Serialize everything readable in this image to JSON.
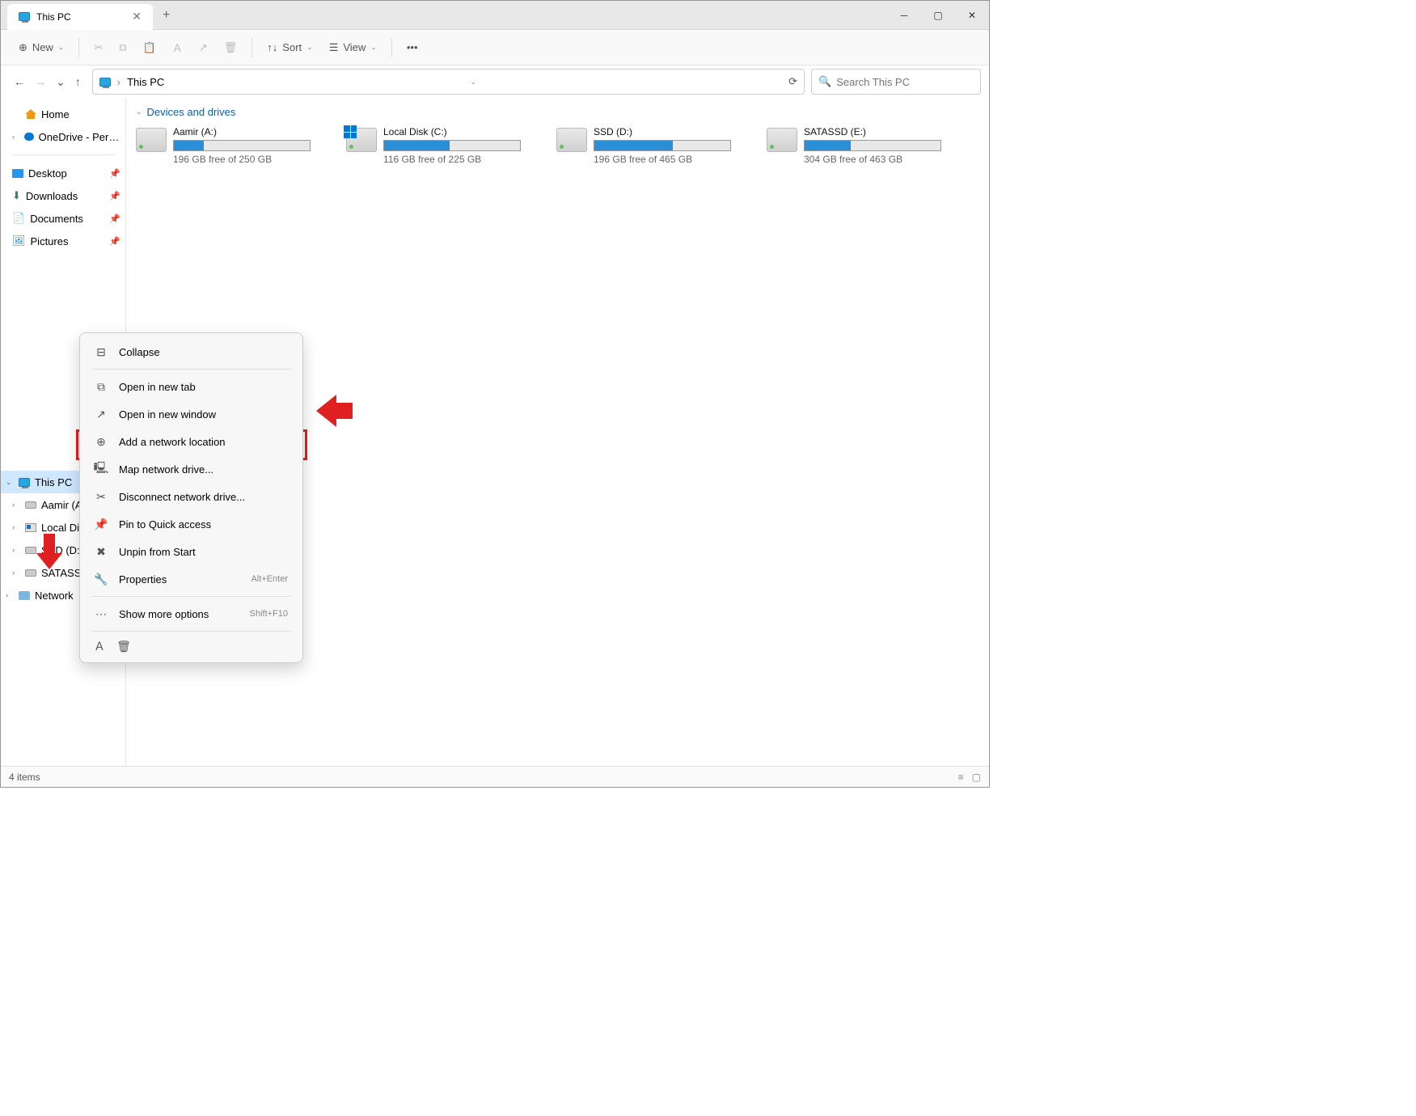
{
  "tab": {
    "title": "This PC"
  },
  "toolbar": {
    "new": "New",
    "sort": "Sort",
    "view": "View"
  },
  "address": {
    "path": "This PC"
  },
  "search": {
    "placeholder": "Search This PC"
  },
  "sidebar": {
    "home": "Home",
    "onedrive": "OneDrive - Personal",
    "quick": {
      "desktop": "Desktop",
      "downloads": "Downloads",
      "documents": "Documents",
      "pictures": "Pictures"
    },
    "thispc": "This PC",
    "drives": {
      "a": "Aamir (A:)",
      "c": "Local Disk (C:)",
      "d": "SSD (D:)",
      "e": "SATASSD (E:)"
    },
    "network": "Network"
  },
  "content": {
    "group": "Devices and drives",
    "drives": [
      {
        "name": "Aamir (A:)",
        "free": "196 GB free of 250 GB",
        "fill": 22
      },
      {
        "name": "Local Disk (C:)",
        "free": "116 GB free of 225 GB",
        "fill": 48,
        "os": true
      },
      {
        "name": "SSD (D:)",
        "free": "196 GB free of 465 GB",
        "fill": 58
      },
      {
        "name": "SATASSD (E:)",
        "free": "304 GB free of 463 GB",
        "fill": 34
      }
    ]
  },
  "ctx": {
    "collapse": "Collapse",
    "open_tab": "Open in new tab",
    "open_win": "Open in new window",
    "add_net": "Add a network location",
    "map_drive": "Map network drive...",
    "disconnect": "Disconnect network drive...",
    "pin_quick": "Pin to Quick access",
    "unpin_start": "Unpin from Start",
    "properties": "Properties",
    "properties_sc": "Alt+Enter",
    "more": "Show more options",
    "more_sc": "Shift+F10"
  },
  "status": {
    "items": "4 items"
  }
}
